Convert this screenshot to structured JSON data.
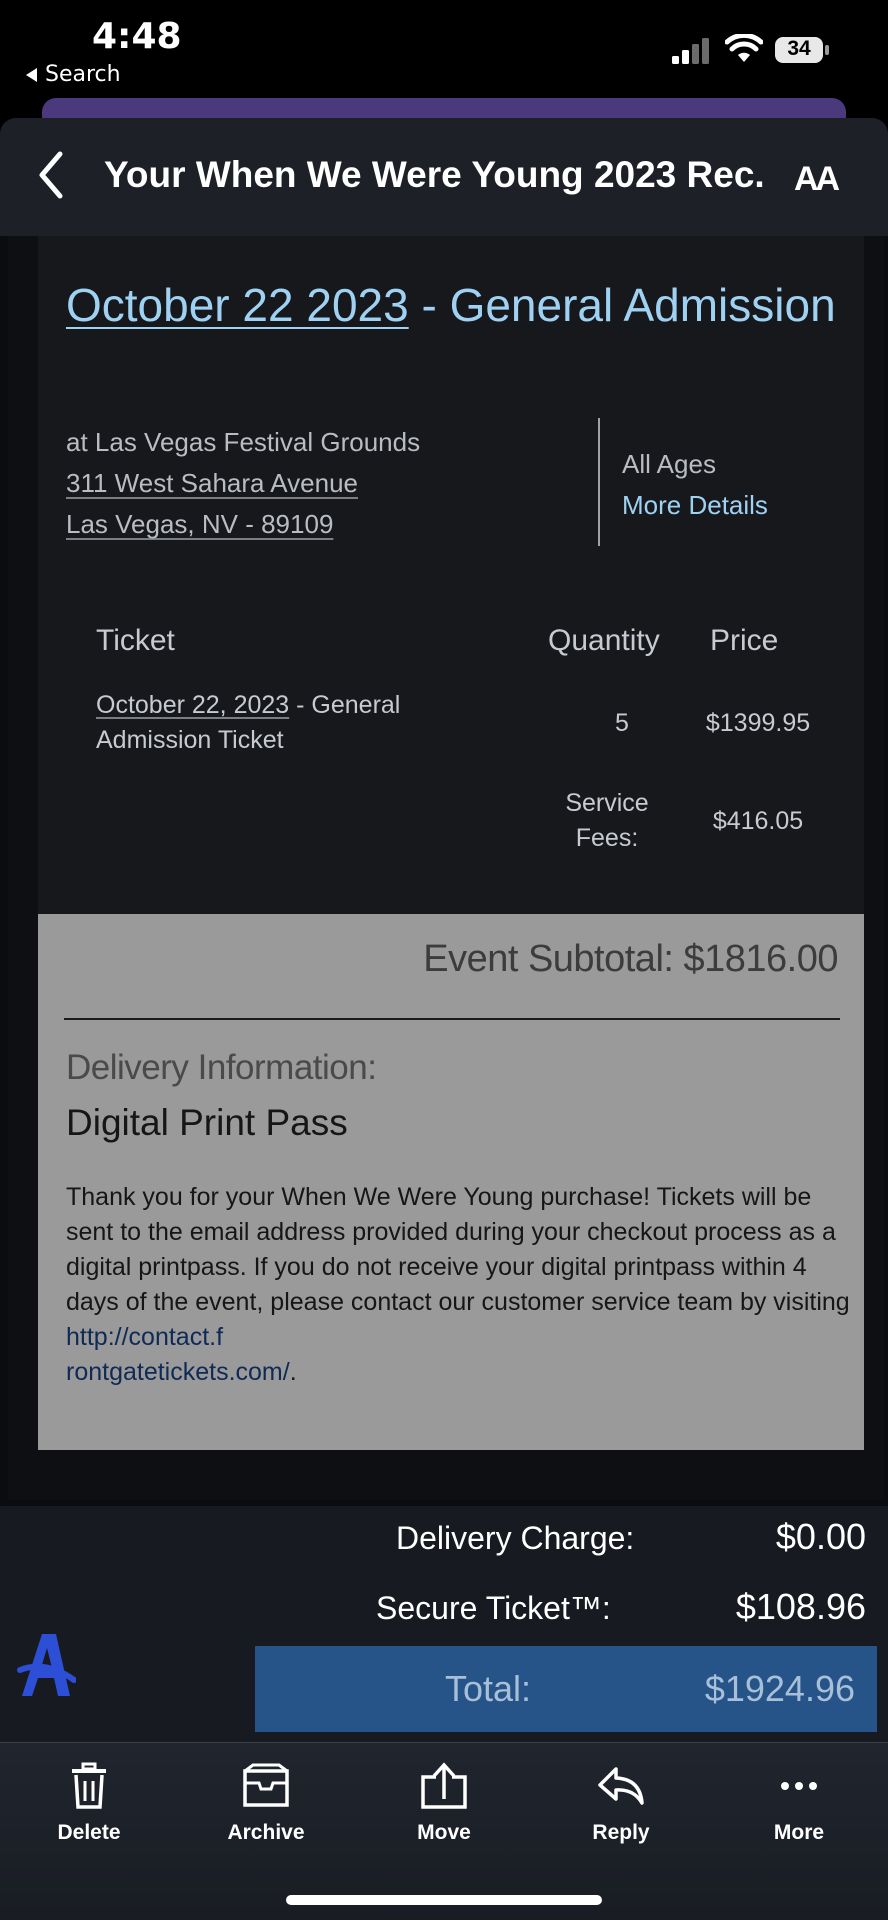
{
  "status_bar": {
    "time": "4:48",
    "back_label": "Search",
    "battery": "34"
  },
  "nav": {
    "title": "Your When We Were Young 2023 Rec...",
    "text_size_label": "AA"
  },
  "event": {
    "title_date": "October 22 2023",
    "title_rest": " - General Admission",
    "venue_line": "at Las Vegas Festival Grounds",
    "address_line1": "311 West Sahara Avenue",
    "address_line2": "Las Vegas, NV - 89109",
    "ages": "All Ages",
    "more_details": "More Details"
  },
  "ticket_table": {
    "headers": {
      "ticket": "Ticket",
      "quantity": "Quantity",
      "price": "Price"
    },
    "row": {
      "name_date": "October 22, 2023",
      "name_rest": " - General Admission Ticket",
      "quantity": "5",
      "price": "$1399.95"
    },
    "service_fees_label": "Service Fees:",
    "service_fees_value": "$416.05"
  },
  "delivery": {
    "subtotal": "Event Subtotal: $1816.00",
    "label": "Delivery Information:",
    "method": "Digital Print Pass",
    "text": "Thank you for your When We Were Young purchase! Tickets will be sent to the email address provided during your checkout process as a digital printpass. If you do not receive your digital printpass within 4 days of the event, please contact our customer service team by visiting ",
    "link_part1": "http://contact.f",
    "link_part2": "rontgatetickets.com/",
    "text_end": "."
  },
  "totals": {
    "delivery_charge_label": "Delivery Charge:",
    "delivery_charge_value": "$0.00",
    "secure_ticket_label": "Secure Ticket™:",
    "secure_ticket_value": "$108.96",
    "total_label": "Total:",
    "total_value": "$1924.96"
  },
  "toolbar": {
    "delete": "Delete",
    "archive": "Archive",
    "move": "Move",
    "reply": "Reply",
    "more": "More"
  },
  "colors": {
    "link_blue": "#9fd1f2",
    "total_bar": "#265489",
    "gray_panel": "#9a9a9a"
  }
}
